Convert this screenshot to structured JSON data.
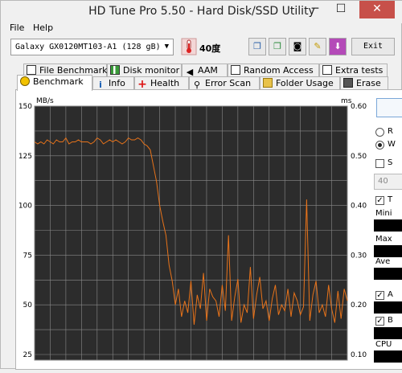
{
  "window": {
    "title": "HD Tune Pro 5.50 - Hard Disk/SSD Utility",
    "minimize": "─",
    "maximize": "☐",
    "close": "✕"
  },
  "menu": {
    "file": "File",
    "help": "Help"
  },
  "toolbar": {
    "drive": "Galaxy GX0120MT103-A1 (128 gB)",
    "temperature": "40度",
    "exit": "Exit"
  },
  "tabs_top": [
    {
      "label": "File Benchmark",
      "icon": "file-benchmark-icon"
    },
    {
      "label": "Disk monitor",
      "icon": "disk-monitor-icon"
    },
    {
      "label": "AAM",
      "icon": "speaker-icon"
    },
    {
      "label": "Random Access",
      "icon": "random-access-icon"
    },
    {
      "label": "Extra tests",
      "icon": "extra-tests-icon"
    }
  ],
  "tabs_bottom": [
    {
      "label": "Benchmark",
      "icon": "benchmark-icon"
    },
    {
      "label": "Info",
      "icon": "info-icon"
    },
    {
      "label": "Health",
      "icon": "health-icon"
    },
    {
      "label": "Error Scan",
      "icon": "magnifier-icon"
    },
    {
      "label": "Folder Usage",
      "icon": "folder-icon"
    },
    {
      "label": "Erase",
      "icon": "trash-icon"
    }
  ],
  "side": {
    "read": "R",
    "write": "W",
    "short": "S",
    "blocks": "40",
    "transfer": "T",
    "minimum": "Mini",
    "maximum": "Max",
    "average": "Ave",
    "access": "A",
    "burst": "B",
    "cpu": "CPU"
  },
  "chart_data": {
    "type": "line",
    "ylabel": "MB/s",
    "y2label": "ms",
    "yticks": [
      150,
      125,
      100,
      75,
      50,
      25
    ],
    "y2ticks": [
      "0.60",
      "0.50",
      "0.40",
      "0.30",
      "0.20",
      "0.10"
    ],
    "ylim": [
      25,
      150
    ],
    "y2lim": [
      0.1,
      0.6
    ],
    "grid": true,
    "series_color": "#e8731a",
    "x": [
      0,
      1,
      2,
      3,
      4,
      5,
      6,
      7,
      8,
      9,
      10,
      11,
      12,
      13,
      14,
      15,
      16,
      17,
      18,
      19,
      20,
      21,
      22,
      23,
      24,
      25,
      26,
      27,
      28,
      29,
      30,
      31,
      32,
      33,
      34,
      35,
      36,
      37,
      38,
      39,
      40,
      41,
      42,
      43,
      44,
      45,
      46,
      47,
      48,
      49,
      50,
      51,
      52,
      53,
      54,
      55,
      56,
      57,
      58,
      59,
      60,
      61,
      62,
      63,
      64,
      65,
      66,
      67,
      68,
      69,
      70,
      71,
      72,
      73,
      74,
      75,
      76,
      77,
      78,
      79,
      80,
      81,
      82,
      83,
      84,
      85,
      86,
      87,
      88,
      89,
      90,
      91,
      92,
      93,
      94,
      95,
      96,
      97,
      98,
      99,
      100
    ],
    "values": [
      132,
      131,
      132,
      131,
      133,
      132,
      131,
      133,
      132,
      132,
      134,
      131,
      132,
      132,
      133,
      132,
      132,
      132,
      131,
      132,
      134,
      133,
      131,
      132,
      133,
      132,
      133,
      132,
      131,
      132,
      134,
      133,
      133,
      134,
      133,
      131,
      130,
      128,
      120,
      112,
      100,
      92,
      85,
      70,
      62,
      50,
      58,
      44,
      52,
      46,
      62,
      40,
      55,
      48,
      66,
      42,
      58,
      54,
      52,
      44,
      60,
      47,
      85,
      42,
      54,
      63,
      41,
      50,
      46,
      69,
      43,
      55,
      64,
      48,
      52,
      42,
      53,
      60,
      45,
      50,
      47,
      58,
      44,
      56,
      52,
      45,
      49,
      103,
      42,
      55,
      62,
      46,
      50,
      44,
      60,
      48,
      41,
      57,
      43,
      58,
      52
    ]
  }
}
